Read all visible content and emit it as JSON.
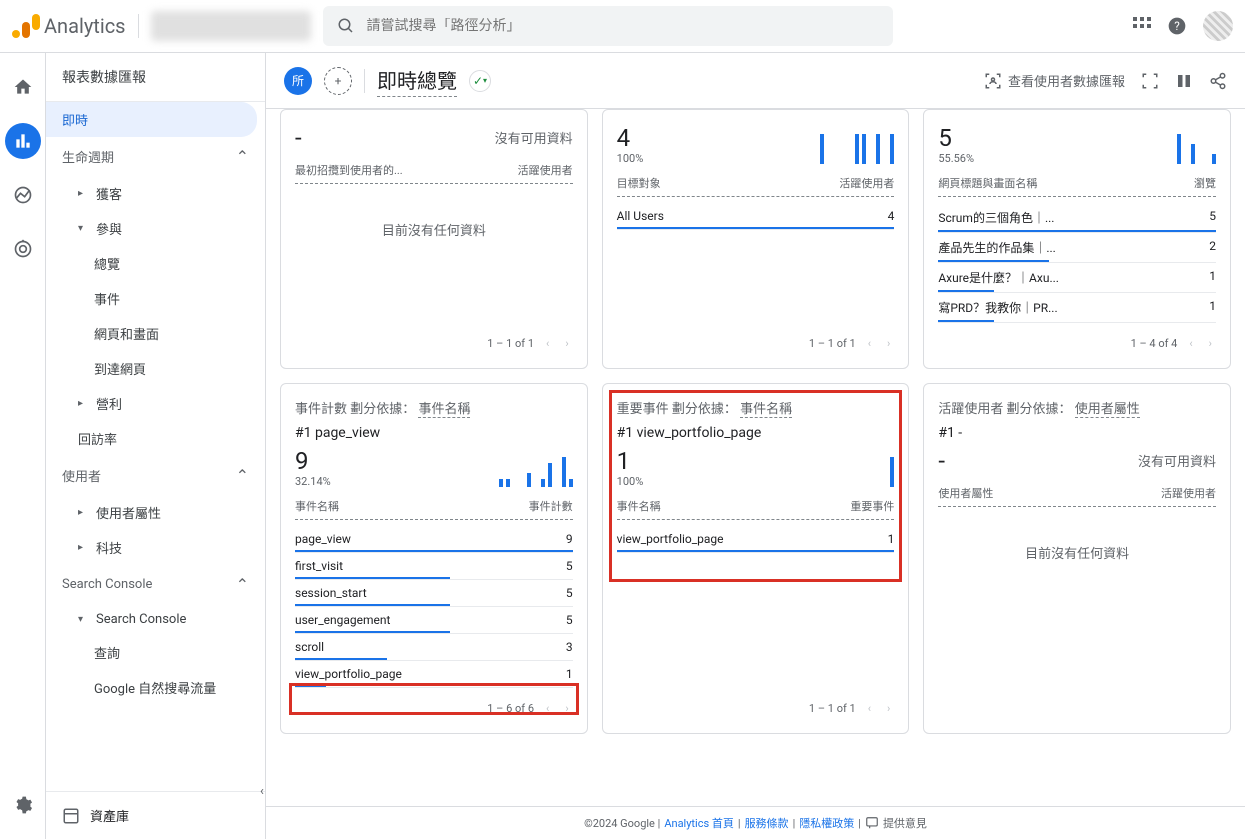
{
  "top": {
    "brand": "Analytics",
    "search_placeholder": "請嘗試搜尋「路徑分析」"
  },
  "sidebar": {
    "header": "報表數據匯報",
    "realtime": "即時",
    "lifecycle": "生命週期",
    "acquisition": "獲客",
    "engagement": "參與",
    "eng_overview": "總覽",
    "eng_events": "事件",
    "eng_pages": "網頁和畫面",
    "eng_landing": "到達網頁",
    "monetization": "營利",
    "retention": "回訪率",
    "user": "使用者",
    "user_attr": "使用者屬性",
    "tech": "科技",
    "sc_section": "Search Console",
    "sc_item": "Search Console",
    "sc_queries": "查詢",
    "sc_organic": "Google 自然搜尋流量",
    "library": "資產庫"
  },
  "page": {
    "all_chip": "所",
    "title": "即時總覽",
    "view_snapshot": "查看使用者數據匯報"
  },
  "card1": {
    "no_data": "沒有可用資料",
    "th1": "最初招攬到使用者的...",
    "th2": "活躍使用者",
    "empty": "目前沒有任何資料",
    "pager": "1 – 1 of 1"
  },
  "card2": {
    "num": "4",
    "pct": "100%",
    "th1": "目標對象",
    "th2": "活躍使用者",
    "rows": [
      {
        "name": "All Users",
        "val": "4"
      }
    ],
    "pager": "1 – 1 of 1"
  },
  "card3": {
    "num": "5",
    "pct": "55.56%",
    "th1": "網頁標題與畫面名稱",
    "th2": "瀏覽",
    "rows": [
      {
        "name": "Scrum的三個角色｜...",
        "val": "5"
      },
      {
        "name": "產品先生的作品集｜...",
        "val": "2"
      },
      {
        "name": "Axure是什麼？｜Axu...",
        "val": "1"
      },
      {
        "name": "寫PRD？我教你｜PR...",
        "val": "1"
      }
    ],
    "pager": "1 – 4 of 4"
  },
  "card4": {
    "title_pre": "事件計數 劃分依據：",
    "title_dim": "事件名稱",
    "top": "#1  page_view",
    "num": "9",
    "pct": "32.14%",
    "th1": "事件名稱",
    "th2": "事件計數",
    "rows": [
      {
        "name": "page_view",
        "val": "9"
      },
      {
        "name": "first_visit",
        "val": "5"
      },
      {
        "name": "session_start",
        "val": "5"
      },
      {
        "name": "user_engagement",
        "val": "5"
      },
      {
        "name": "scroll",
        "val": "3"
      },
      {
        "name": "view_portfolio_page",
        "val": "1"
      }
    ],
    "pager": "1 – 6 of 6"
  },
  "card5": {
    "title_pre": "重要事件 劃分依據：",
    "title_dim": "事件名稱",
    "top": "#1  view_portfolio_page",
    "num": "1",
    "pct": "100%",
    "th1": "事件名稱",
    "th2": "重要事件",
    "rows": [
      {
        "name": "view_portfolio_page",
        "val": "1"
      }
    ],
    "pager": "1 – 1 of 1"
  },
  "card6": {
    "title_pre": "活躍使用者 劃分依據：",
    "title_dim": "使用者屬性",
    "top": "#1  -",
    "num": "-",
    "no_data": "沒有可用資料",
    "th1": "使用者屬性",
    "th2": "活躍使用者",
    "empty": "目前沒有任何資料"
  },
  "footer": {
    "copy": "©2024 Google |",
    "home": "Analytics 首頁",
    "terms": "服務條款",
    "privacy": "隱私權政策",
    "feedback": "提供意見"
  },
  "chart_data": [
    {
      "type": "bar",
      "card": 2,
      "values": [
        0,
        0,
        0,
        0,
        0,
        0,
        0,
        0,
        0,
        0,
        0,
        0,
        0,
        0,
        0,
        0,
        0,
        1,
        0,
        0,
        0,
        0,
        0,
        1,
        1,
        0,
        1,
        0,
        1,
        0
      ]
    },
    {
      "type": "bar",
      "card": 3,
      "values": [
        0,
        0,
        0,
        0,
        0,
        0,
        0,
        0,
        0,
        0,
        0,
        0,
        0,
        0,
        0,
        0,
        0,
        0,
        0,
        0,
        0,
        0,
        0,
        3,
        0,
        2,
        0,
        0,
        0,
        1
      ]
    },
    {
      "type": "bar",
      "card": 4,
      "title": "event_count",
      "values": [
        0,
        0,
        0,
        0,
        0,
        0,
        0,
        0,
        0,
        0,
        0,
        0,
        0,
        0,
        0,
        1,
        1,
        0,
        0,
        0,
        0,
        0,
        0,
        2,
        0,
        4,
        0,
        0,
        5,
        1
      ]
    },
    {
      "type": "bar",
      "card": 5,
      "values": [
        0,
        0,
        0,
        0,
        0,
        0,
        0,
        0,
        0,
        0,
        0,
        0,
        0,
        0,
        0,
        0,
        0,
        0,
        0,
        0,
        0,
        0,
        0,
        0,
        0,
        0,
        0,
        0,
        0,
        1
      ]
    }
  ]
}
